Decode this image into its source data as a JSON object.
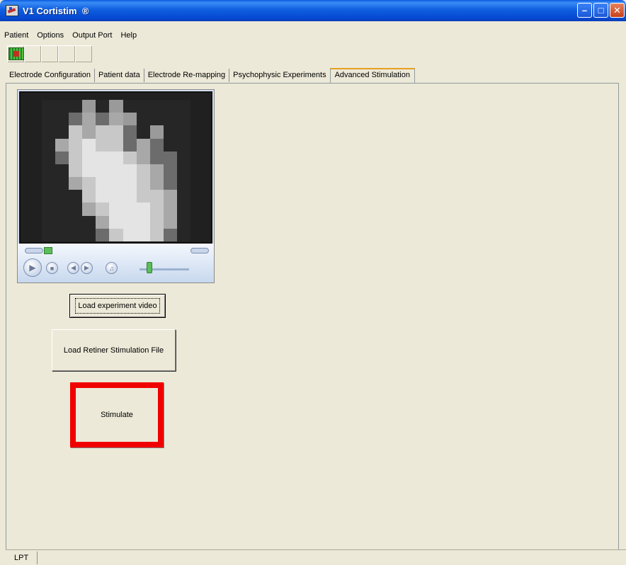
{
  "window": {
    "title": "V1 Cortistim",
    "title_symbol": "®",
    "controls": [
      "minimize",
      "maximize",
      "close"
    ]
  },
  "menu": {
    "items": [
      {
        "label": "Patient"
      },
      {
        "label": "Options"
      },
      {
        "label": "Output Port"
      },
      {
        "label": "Help"
      }
    ]
  },
  "toolbar": {
    "buttons": [
      {
        "icon": "grid-icon"
      },
      {
        "icon": ""
      },
      {
        "icon": ""
      },
      {
        "icon": ""
      },
      {
        "icon": ""
      }
    ]
  },
  "tabs": [
    {
      "label": "Electrode Configuration",
      "active": false
    },
    {
      "label": "Patient data",
      "active": false
    },
    {
      "label": "Electrode Re-mapping",
      "active": false
    },
    {
      "label": "Psychophysic Experiments",
      "active": false
    },
    {
      "label": "Advanced Stimulation",
      "active": true
    }
  ],
  "player": {
    "video_content": "pixelated-hand",
    "icons": [
      "play-icon",
      "stop-icon",
      "previous-icon",
      "next-icon",
      "mute-icon",
      "volume-slider"
    ]
  },
  "buttons": {
    "load_video": "Load experiment video",
    "load_retiner": "Load Retiner Stimulation File",
    "stimulate": "Stimulate"
  },
  "colors": {
    "stimulate_border": "#f00000",
    "title_bar": "#0a5ae0",
    "window_bg": "#ece9d8"
  },
  "statusbar": {
    "port": "LPT"
  }
}
